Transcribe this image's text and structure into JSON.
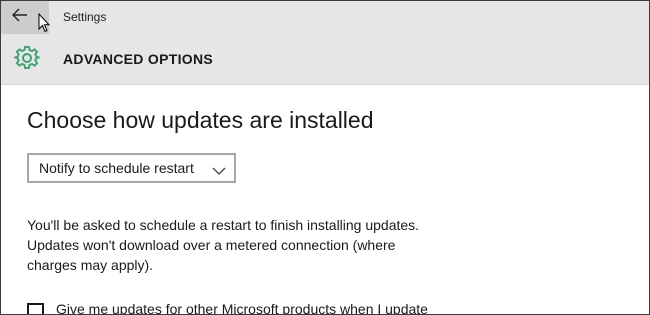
{
  "window": {
    "title": "Settings"
  },
  "header": {
    "title": "ADVANCED OPTIONS",
    "icon": "gear-icon",
    "accent_color": "#3aa36f"
  },
  "main": {
    "section_title": "Choose how updates are installed",
    "install_dropdown": {
      "selected": "Notify to schedule restart"
    },
    "description_lines": [
      "You'll be asked to schedule a restart to finish installing updates.",
      "Updates won't download over a metered connection (where",
      "charges may apply)."
    ],
    "other_products_checkbox": {
      "label": "Give me updates for other Microsoft products when I update",
      "checked": false
    }
  }
}
